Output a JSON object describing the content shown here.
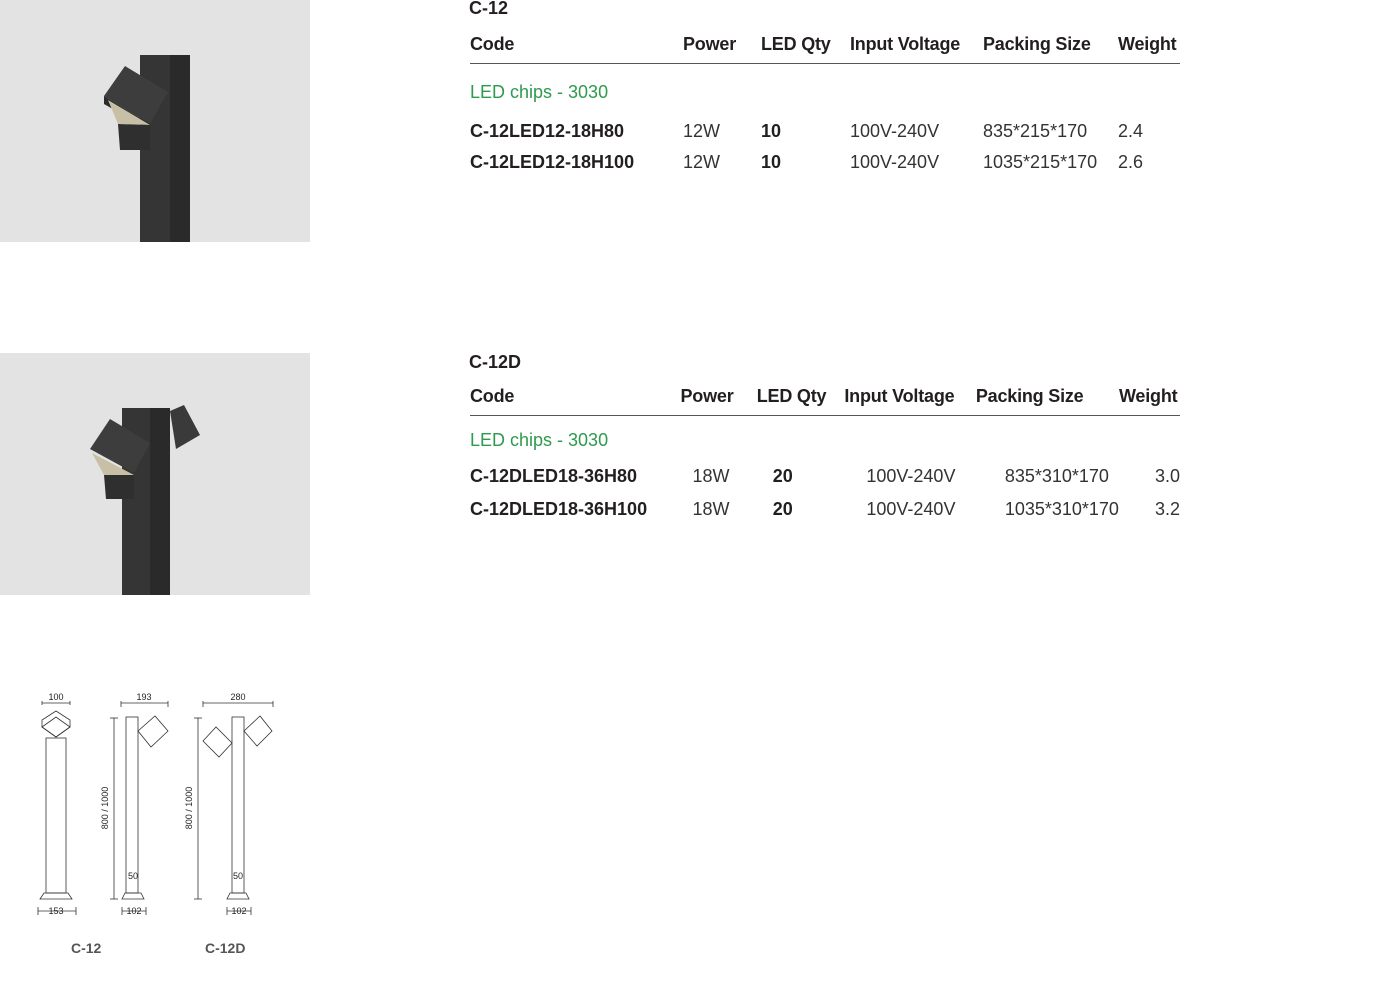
{
  "products": [
    {
      "title": "C-12",
      "headers": [
        "Code",
        "Power",
        "LED Qty",
        "Input Voltage",
        "Packing Size",
        "Weight"
      ],
      "chips_label": "LED chips - 3030",
      "rows": [
        {
          "code": "C-12LED12-18H80",
          "power": "12W",
          "qty": "10",
          "voltage": "100V-240V",
          "packing": "835*215*170",
          "weight": "2.4"
        },
        {
          "code": "C-12LED12-18H100",
          "power": "12W",
          "qty": "10",
          "voltage": "100V-240V",
          "packing": "1035*215*170",
          "weight": "2.6"
        }
      ]
    },
    {
      "title": "C-12D",
      "headers": [
        "Code",
        "Power",
        "LED Qty",
        "Input Voltage",
        "Packing Size",
        "Weight"
      ],
      "chips_label": "LED chips - 3030",
      "rows": [
        {
          "code": "C-12DLED18-36H80",
          "power": "18W",
          "qty": "20",
          "voltage": "100V-240V",
          "packing": "835*310*170",
          "weight": "3.0"
        },
        {
          "code": "C-12DLED18-36H100",
          "power": "18W",
          "qty": "20",
          "voltage": "100V-240V",
          "packing": "1035*310*170",
          "weight": "3.2"
        }
      ]
    }
  ],
  "drawings": {
    "c12": {
      "label": "C-12",
      "top_width": "100",
      "base_width": "153"
    },
    "c12_side": {
      "top_width": "193",
      "height": "800 / 1000",
      "post": "50",
      "base": "102"
    },
    "c12d": {
      "label": "C-12D",
      "top_width": "280",
      "height": "800 / 1000",
      "post": "50",
      "base": "102"
    }
  },
  "colors": {
    "accent_green": "#2e9a4d",
    "text": "#231f20",
    "photo_bg": "#e3e3e3",
    "fixture": "#3a3a3a"
  }
}
